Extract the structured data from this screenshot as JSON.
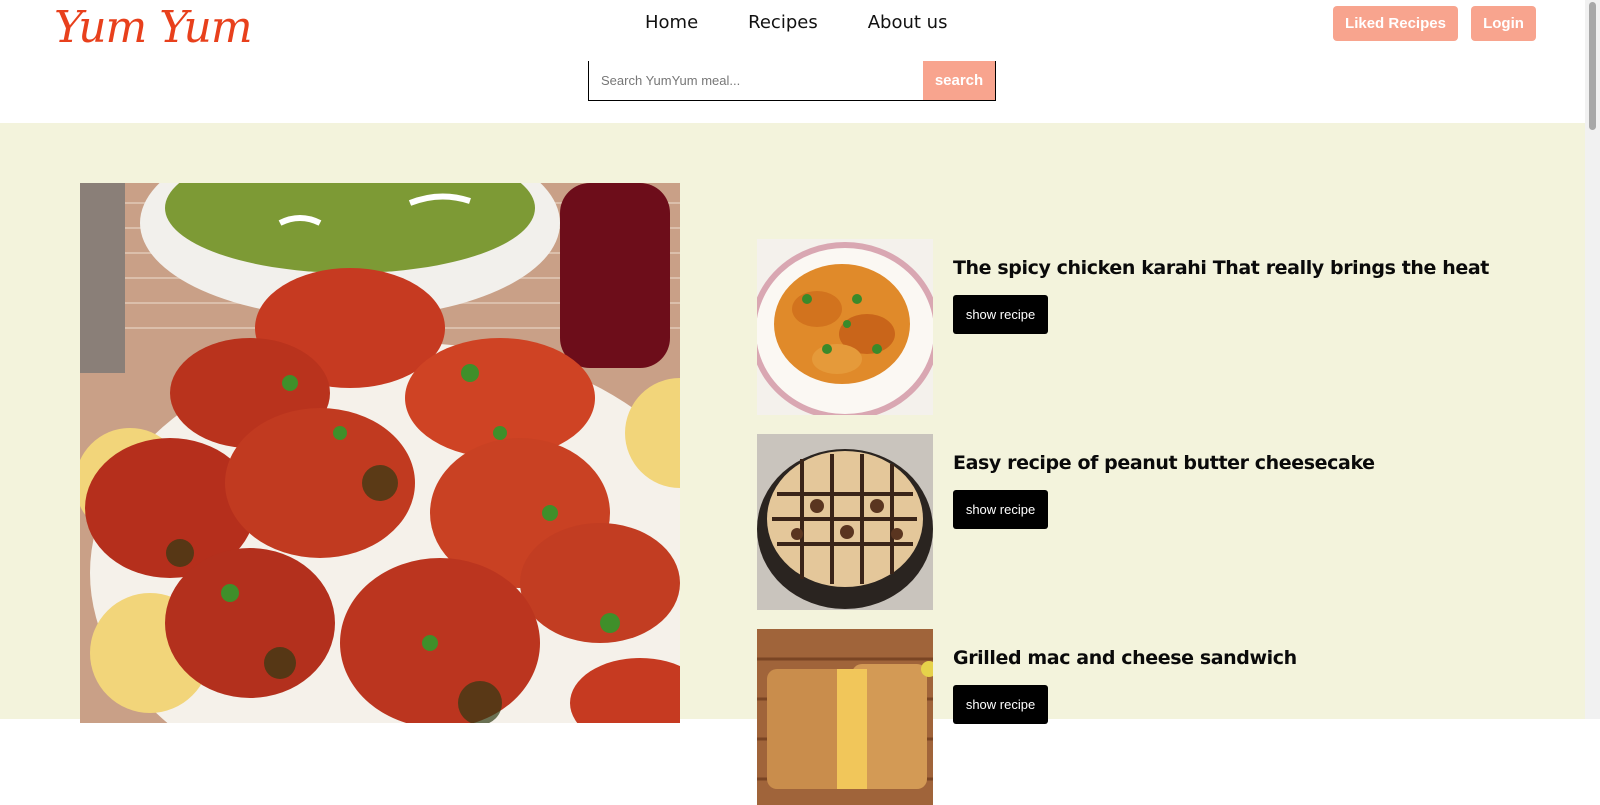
{
  "brand": {
    "logo_text": "Yum Yum"
  },
  "nav": {
    "items": [
      "Home",
      "Recipes",
      "About us"
    ]
  },
  "header_buttons": {
    "liked": "Liked Recipes",
    "login": "Login"
  },
  "search": {
    "placeholder": "Search YumYum meal...",
    "button": "search"
  },
  "recipes": [
    {
      "title": "The spicy chicken karahi That really brings the heat",
      "button": "show recipe",
      "image": "chicken-karahi"
    },
    {
      "title": "Easy recipe of peanut butter cheesecake",
      "button": "show recipe",
      "image": "peanut-butter-cheesecake"
    },
    {
      "title": "Grilled mac and cheese sandwich",
      "button": "show recipe",
      "image": "grilled-mac-cheese-sandwich"
    }
  ],
  "hero": {
    "image": "tandoori-chicken-platter"
  },
  "colors": {
    "accent": "#f8a48e",
    "logo": "#e8401c",
    "section_bg": "#f3f3dc"
  }
}
